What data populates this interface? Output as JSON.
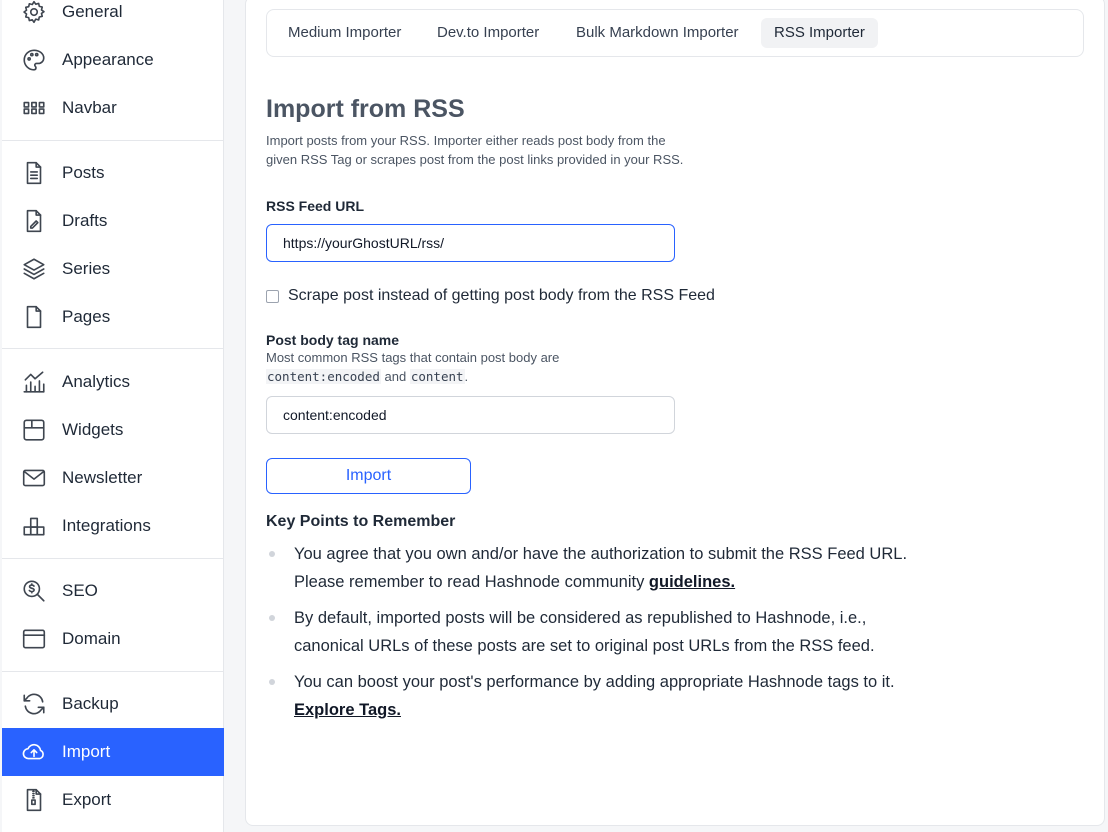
{
  "sidebar": {
    "items": [
      {
        "label": "General",
        "icon": "gear-icon"
      },
      {
        "label": "Appearance",
        "icon": "palette-icon"
      },
      {
        "label": "Navbar",
        "icon": "grid-icon"
      },
      {
        "label": "Posts",
        "icon": "document-icon"
      },
      {
        "label": "Drafts",
        "icon": "draft-icon"
      },
      {
        "label": "Series",
        "icon": "layers-icon"
      },
      {
        "label": "Pages",
        "icon": "page-icon"
      },
      {
        "label": "Analytics",
        "icon": "analytics-icon"
      },
      {
        "label": "Widgets",
        "icon": "widget-icon"
      },
      {
        "label": "Newsletter",
        "icon": "mail-icon"
      },
      {
        "label": "Integrations",
        "icon": "blocks-icon"
      },
      {
        "label": "SEO",
        "icon": "seo-search-icon"
      },
      {
        "label": "Domain",
        "icon": "browser-window-icon"
      },
      {
        "label": "Backup",
        "icon": "sync-icon"
      },
      {
        "label": "Import",
        "icon": "cloud-upload-icon"
      },
      {
        "label": "Export",
        "icon": "zip-file-icon"
      }
    ],
    "active": "Import",
    "accent_color": "#2962ff"
  },
  "tabs": {
    "items": [
      "Medium Importer",
      "Dev.to Importer",
      "Bulk Markdown Importer",
      "RSS Importer"
    ],
    "active": "RSS Importer"
  },
  "form": {
    "title": "Import from RSS",
    "description": "Import posts from your RSS. Importer either reads post body from the given RSS Tag or scrapes post from the post links provided in your RSS.",
    "feed_url_label": "RSS Feed URL",
    "feed_url_value": "https://yourGhostURL/rss/",
    "scrape_checkbox_label": "Scrape post instead of getting post body from the RSS Feed",
    "scrape_checked": false,
    "tag_label": "Post body tag name",
    "tag_hint_prefix": "Most common RSS tags that contain post body are",
    "tag_hint_code1": "content:encoded",
    "tag_hint_and": "and",
    "tag_hint_code2": "content",
    "tag_hint_suffix": ".",
    "tag_value": "content:encoded",
    "import_button": "Import"
  },
  "key_points": {
    "title": "Key Points to Remember",
    "items": [
      {
        "text": "You agree that you own and/or have the authorization to submit the RSS Feed URL. Please remember to read Hashnode community ",
        "link": "guidelines."
      },
      {
        "text": "By default, imported posts will be considered as republished to Hashnode, i.e., canonical URLs of these posts are set to original post URLs from the RSS feed.",
        "link": ""
      },
      {
        "text": "You can boost your post's performance by adding appropriate Hashnode tags to it. ",
        "link": "Explore Tags."
      }
    ]
  }
}
